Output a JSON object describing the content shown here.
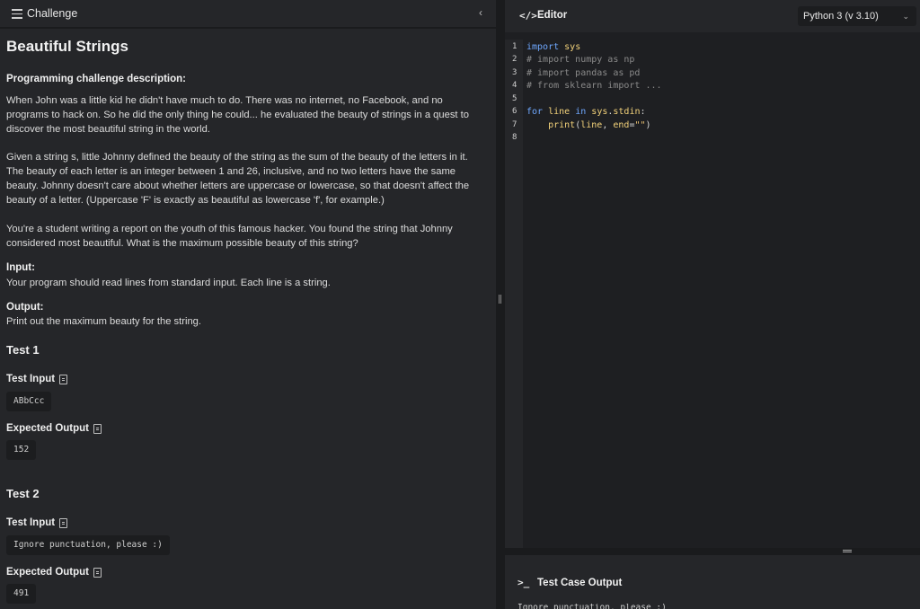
{
  "left_panel": {
    "header_title": "Challenge",
    "collapse_icon": "‹",
    "challenge_title": "Beautiful Strings",
    "description_label": "Programming challenge description:",
    "paragraphs": [
      "When John was a little kid he didn't have much to do. There was no internet, no Facebook, and no programs to hack on. So he did the only thing he could... he evaluated the beauty of strings in a quest to discover the most beautiful string in the world.",
      "Given a string s, little Johnny defined the beauty of the string as the sum of the beauty of the letters in it. The beauty of each letter is an integer between 1 and 26, inclusive, and no two letters have the same beauty. Johnny doesn't care about whether letters are uppercase or lowercase, so that doesn't affect the beauty of a letter. (Uppercase 'F' is exactly as beautiful as lowercase 'f', for example.)",
      "You're a student writing a report on the youth of this famous hacker. You found the string that Johnny considered most beautiful. What is the maximum possible beauty of this string?"
    ],
    "input_label": "Input:",
    "input_text": "Your program should read lines from standard input. Each line is a string.",
    "output_label": "Output:",
    "output_text": "Print out the maximum beauty for the string.",
    "tests": [
      {
        "heading": "Test 1",
        "input_label": "Test Input",
        "input_value": "ABbCcc",
        "output_label": "Expected Output",
        "output_value": "152"
      },
      {
        "heading": "Test 2",
        "input_label": "Test Input",
        "input_value": "Ignore punctuation, please :)",
        "output_label": "Expected Output",
        "output_value": "491"
      }
    ]
  },
  "editor": {
    "icon": "</>",
    "title": "Editor",
    "language": "Python 3 (v 3.10)",
    "line_numbers": [
      "1",
      "2",
      "3",
      "4",
      "5",
      "6",
      "7",
      "8"
    ]
  },
  "output_panel": {
    "icon": ">_",
    "title": "Test Case Output",
    "cut_text": "Ignore punctuation, please :)"
  }
}
